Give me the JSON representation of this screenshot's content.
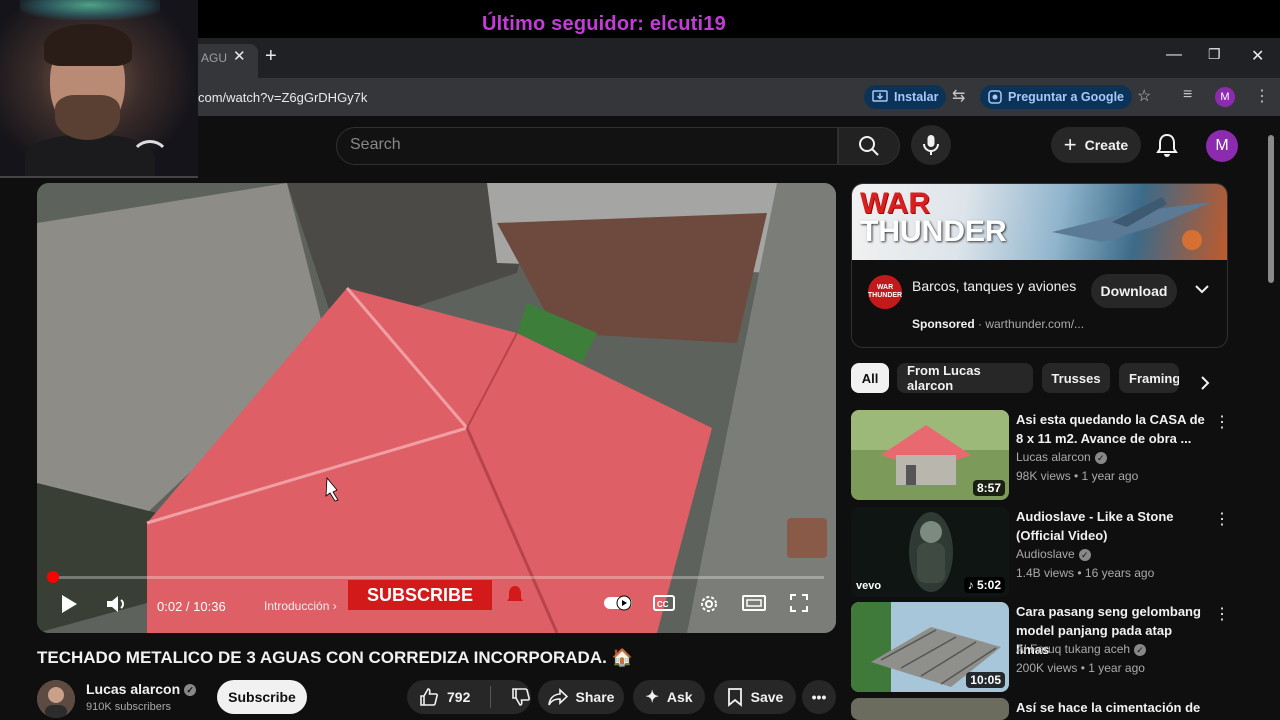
{
  "stream_overlay": {
    "follower_text": "Último seguidor: elcuti19"
  },
  "browser": {
    "tab_title": "AGU",
    "url": "com/watch?v=Z6gGrDHGy7k",
    "install_label": "Instalar",
    "ask_google_label": "Preguntar a Google",
    "profile_initial": "M"
  },
  "header": {
    "search_placeholder": "Search",
    "create_label": "Create",
    "avatar_initial": "M"
  },
  "player": {
    "current_time": "0:02",
    "duration": "10:36",
    "time_display": "0:02 / 10:36",
    "chapter": "Introducción",
    "subscribe_overlay": "SUBSCRIBE",
    "progress_fraction": 0.003
  },
  "video": {
    "title": "TECHADO METALICO DE 3 AGUAS CON CORREDIZA INCORPORADA. 🏠",
    "channel": "Lucas alarcon",
    "subscribers": "910K subscribers",
    "subscribe_label": "Subscribe",
    "likes": "792",
    "share_label": "Share",
    "ask_label": "Ask",
    "save_label": "Save"
  },
  "ad": {
    "banner_word1": "WAR",
    "banner_word2": "THUNDER",
    "icon_text": "WAR THUNDER",
    "title": "Barcos, tanques y aviones",
    "sponsored_label": "Sponsored",
    "domain": "warthunder.com/...",
    "download_label": "Download"
  },
  "chips": [
    {
      "label": "All"
    },
    {
      "label": "From Lucas alarcon"
    },
    {
      "label": "Trusses"
    },
    {
      "label": "Framing"
    }
  ],
  "recommendations": [
    {
      "title": "Asi esta quedando la CASA de 8 x 11 m2. Avance de obra ...",
      "channel": "Lucas alarcon",
      "meta": "98K views • 1 year ago",
      "duration": "8:57"
    },
    {
      "title": "Audioslave - Like a Stone (Official Video)",
      "channel": "Audioslave",
      "meta": "1.4B views • 16 years ago",
      "duration": "♪ 5:02",
      "thumb_tag": "vevo"
    },
    {
      "title": "Cara pasang seng gelombang model panjang pada atap limas",
      "channel": "Al Faruq tukang aceh",
      "meta": "200K views • 1 year ago",
      "duration": "10:05"
    },
    {
      "title": "Así se hace la cimentación de"
    }
  ],
  "colors": {
    "accent_red": "#ff0000",
    "follower_purple": "#c23dd6",
    "avatar_purple": "#8c2bb0",
    "chip_active_bg": "#f1f1f1"
  }
}
